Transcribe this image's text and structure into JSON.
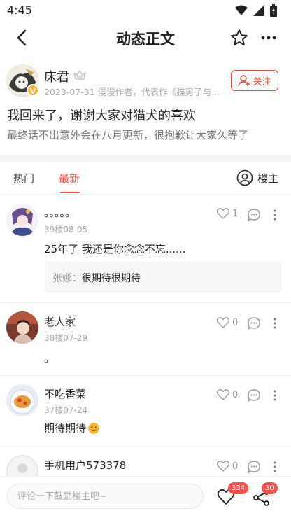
{
  "status_bar": {
    "time": "4:45"
  },
  "nav": {
    "title": "动态正文"
  },
  "author": {
    "name": "床君",
    "vip_mark": "V",
    "meta": "2023-07-31  漫漫作者，代表作《猫男子与...",
    "follow_label": "关注"
  },
  "post": {
    "title": "我回来了，谢谢大家对猫犬的喜欢",
    "body": "最终话不出意外会在八月更新，很抱歉让大家久等了"
  },
  "tabs": {
    "hot": "热门",
    "latest": "最新",
    "owner": "楼主"
  },
  "comments": [
    {
      "name": "。。。。。",
      "meta": "39楼08-05",
      "likes": "1",
      "text": "25年了 我还是你念念不忘......",
      "sub_author": "张娜：",
      "sub_text": "很期待很期待"
    },
    {
      "name": "老人家",
      "meta": "38楼07-29",
      "likes": "0",
      "text": "。"
    },
    {
      "name": "不吃香菜",
      "meta": "37楼07-24",
      "likes": "0",
      "text": "期待期待"
    },
    {
      "name": "手机用户573378",
      "likes": "0"
    }
  ],
  "bottom": {
    "placeholder": "评论一下鼓励楼主吧~",
    "like_count": "334",
    "share_count": "30"
  },
  "colors": {
    "accent": "#e84a3c",
    "badge": "#f2544b"
  },
  "icons": [
    "wifi-icon",
    "signal-icon",
    "battery-icon",
    "back-arrow-icon",
    "star-icon",
    "more-icon",
    "crown-icon",
    "follow-user-icon",
    "owner-icon",
    "heart-icon",
    "comment-bubble-icon",
    "vertical-dots-icon",
    "share-icon",
    "emoji-icon"
  ]
}
